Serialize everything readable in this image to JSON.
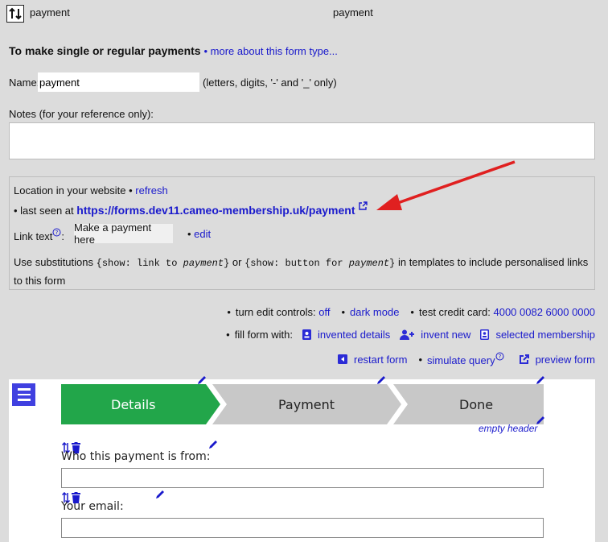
{
  "top": {
    "title_left": "payment",
    "title_center": "payment"
  },
  "heading": {
    "title": "To make single or regular payments",
    "more_link": "• more about this form type..."
  },
  "name": {
    "label": "Name:",
    "value": "payment",
    "hint": "(letters, digits, '-' and '_' only)"
  },
  "notes": {
    "label": "Notes (for your reference only):",
    "value": ""
  },
  "location": {
    "title": "Location in your website •",
    "refresh": "refresh",
    "seen_prefix": "• last seen at",
    "url": "https://forms.dev11.cameo-membership.uk/payment",
    "link_text_label": "Link text",
    "link_text_colon": ":",
    "link_text_value": "Make a payment here",
    "edit": "edit",
    "subst_1": "Use substitutions",
    "code_1a": "{show: link to ",
    "code_1b": "payment",
    "code_1c": "}",
    "subst_or": "or",
    "code_2a": "{show: button for ",
    "code_2b": "payment",
    "code_2c": "}",
    "subst_2": "in templates to include personalised links to this form"
  },
  "controls": {
    "edit_controls_label": "turn edit controls:",
    "edit_controls_value": "off",
    "dark_mode": "dark mode",
    "test_card_label": "test credit card:",
    "test_card_value": "4000 0082 6000 0000",
    "fill_label": "fill form with:",
    "invented_details": "invented details",
    "invent_new": "invent new",
    "selected_membership": "selected membership",
    "restart_form": "restart form",
    "simulate_query": "simulate query",
    "preview_form": "preview form"
  },
  "form": {
    "steps": [
      "Details",
      "Payment",
      "Done"
    ],
    "empty_header": "empty header",
    "fields": [
      {
        "label": "Who this payment is from:",
        "value": ""
      },
      {
        "label": "Your email:",
        "value": ""
      }
    ]
  },
  "colors": {
    "accent": "#1a1acc",
    "step_active": "#22a64a",
    "step_inactive": "#c8c8c8",
    "arrow": "#e02020"
  }
}
